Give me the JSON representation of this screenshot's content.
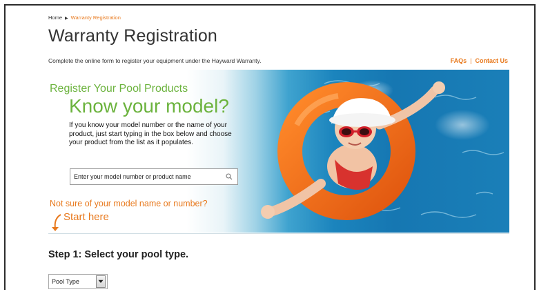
{
  "breadcrumb": {
    "home": "Home",
    "separator": "▶",
    "current": "Warranty Registration"
  },
  "page": {
    "title": "Warranty Registration",
    "subtitle": "Complete the online form to register your equipment under the Hayward Warranty."
  },
  "links": {
    "faqs": "FAQs",
    "divider": "|",
    "contact": "Contact Us"
  },
  "hero": {
    "heading": "Register Your Pool Products",
    "big": "Know your model?",
    "body": "If you know your model number or the name of your product, just start typing in the box below and choose your product from the list as it populates.",
    "not_sure": "Not sure of your model name or number?",
    "start_here": "Start here"
  },
  "search": {
    "placeholder": "Enter your model number or product name",
    "icon": "search-icon"
  },
  "step1": {
    "title": "Step 1: Select your pool type."
  },
  "pool_type": {
    "selected": "Pool Type",
    "icon": "chevron-down-icon"
  },
  "colors": {
    "accent": "#e8791d",
    "green": "#6cb33e",
    "water": "#1677b2"
  }
}
